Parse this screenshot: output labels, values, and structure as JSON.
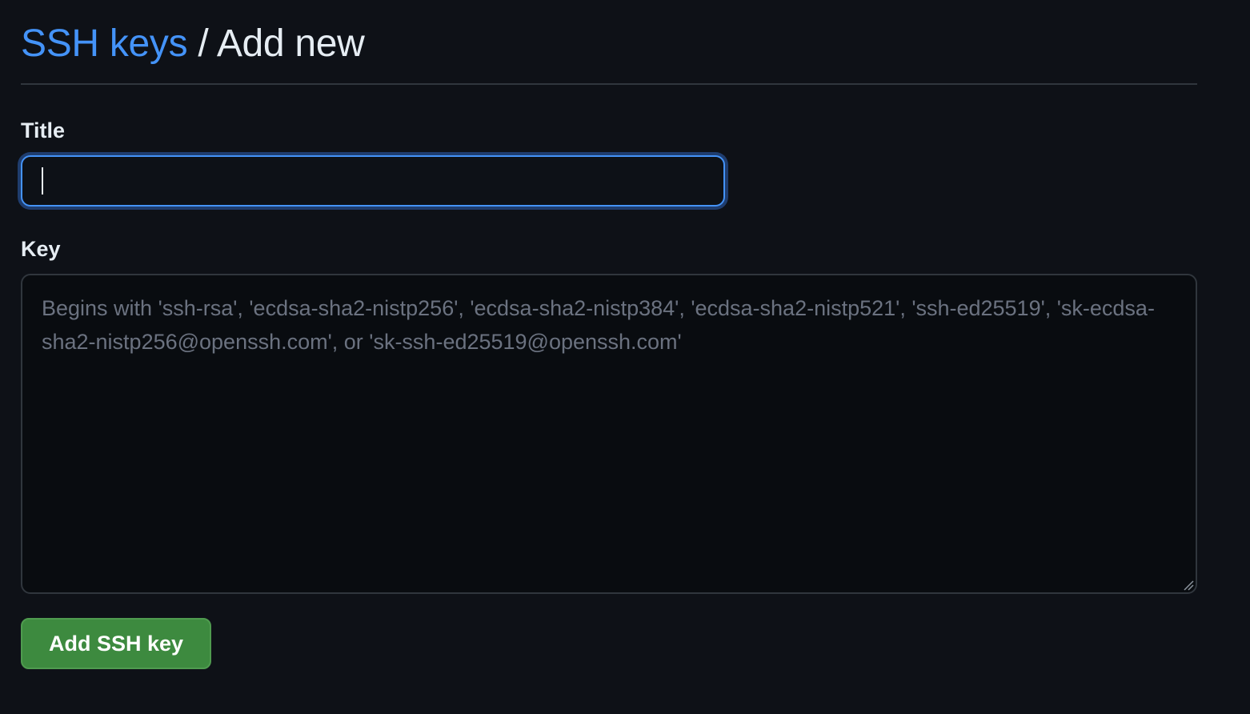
{
  "header": {
    "breadcrumb_link": "SSH keys",
    "separator": "/",
    "current": "Add new"
  },
  "form": {
    "title_label": "Title",
    "title_value": "",
    "key_label": "Key",
    "key_placeholder": "Begins with 'ssh-rsa', 'ecdsa-sha2-nistp256', 'ecdsa-sha2-nistp384', 'ecdsa-sha2-nistp521', 'ssh-ed25519', 'sk-ecdsa-sha2-nistp256@openssh.com', or 'sk-ssh-ed25519@openssh.com'",
    "key_value": "",
    "submit_label": "Add SSH key"
  },
  "colors": {
    "background": "#0e1117",
    "link": "#4493f8",
    "focus_border": "#4493f8",
    "button": "#3d8a3f"
  },
  "icons": {
    "resize": "textarea-resize-icon"
  }
}
